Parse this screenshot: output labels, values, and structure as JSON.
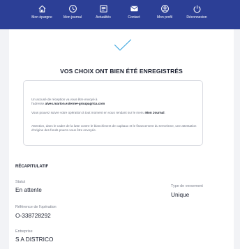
{
  "nav": [
    {
      "label": "Mon épargne",
      "icon": "home-icon"
    },
    {
      "label": "Mon journal",
      "icon": "clock-icon"
    },
    {
      "label": "Actualités",
      "icon": "news-icon"
    },
    {
      "label": "Contact",
      "icon": "envelope-icon"
    },
    {
      "label": "Mon profil",
      "icon": "user-icon"
    },
    {
      "label": "Déconnexion",
      "icon": "power-icon"
    }
  ],
  "confirmation": {
    "title": "VOS CHOIX ONT BIEN ÉTÉ ENREGISTRÉS",
    "p1_prefix": "Un accusé de réception va vous être envoyé à",
    "p1_line2": "l'adresse",
    "email": "alves.marion.externe+groupagrica.com",
    "p2_text": "Vous pouvez suivre votre opération à tout moment en vous rendant sur le menu",
    "p2_link": "Mon Journal",
    "p3": "Attention, dans le cadre de la lutte contre le blanchiment de capitaux et le financement du terrorisme, une attestation d'origine des fonds pourra vous être envoyée."
  },
  "recap": {
    "title": "RÉCAPITULATIF",
    "statut_label": "Statut",
    "statut_value": "En attente",
    "type_label": "Type de versement",
    "type_value": "Unique",
    "ref_label": "Référence de l'opération",
    "ref_value": "O-338728292",
    "entreprise_label": "Entreprise",
    "entreprise_value": "S A DISTRICO"
  },
  "colors": {
    "header": "#2c3f96",
    "accent": "#3fa7e0"
  }
}
